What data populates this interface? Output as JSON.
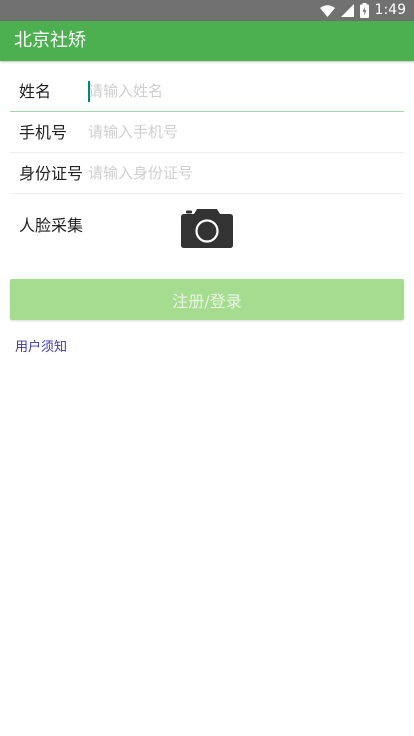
{
  "status_bar": {
    "time": "1:49",
    "icons": [
      "wifi-icon",
      "signal-icon",
      "battery-charging-icon"
    ]
  },
  "app_bar": {
    "title": "北京社矫",
    "background": "#4caf50"
  },
  "form": {
    "name": {
      "label": "姓名",
      "placeholder": "请输入姓名",
      "value": ""
    },
    "phone": {
      "label": "手机号",
      "placeholder": "请输入手机号",
      "value": ""
    },
    "id_card": {
      "label": "身份证号",
      "placeholder": "请输入身份证号",
      "value": ""
    },
    "face": {
      "label": "人脸采集",
      "icon": "camera-icon"
    }
  },
  "submit": {
    "label": "注册/登录",
    "color": "#a5dc90"
  },
  "notice": {
    "label": "用户须知",
    "color": "#3b3b9c"
  }
}
